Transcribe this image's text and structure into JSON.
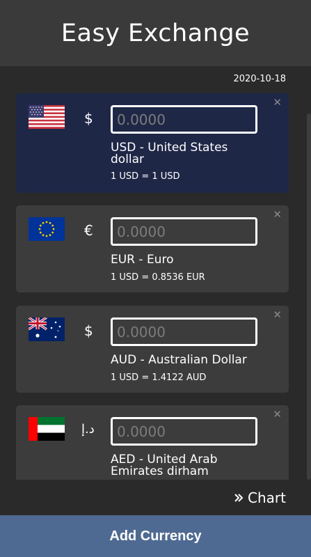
{
  "header": {
    "title": "Easy Exchange"
  },
  "date": "2020-10-18",
  "currencies": [
    {
      "code_name": "USD - United States dollar",
      "symbol": "$",
      "placeholder": "0.0000",
      "rate": "1 USD = 1 USD",
      "flag": "us-flag",
      "active": true
    },
    {
      "code_name": "EUR - Euro",
      "symbol": "€",
      "placeholder": "0.0000",
      "rate": "1 USD = 0.8536 EUR",
      "flag": "eu-flag",
      "active": false
    },
    {
      "code_name": "AUD - Australian Dollar",
      "symbol": "$",
      "placeholder": "0.0000",
      "rate": "1 USD = 1.4122 AUD",
      "flag": "au-flag",
      "active": false
    },
    {
      "code_name": "AED - United Arab Emirates dirham",
      "symbol": "د.إ",
      "placeholder": "0.0000",
      "rate": "",
      "flag": "ae-flag",
      "active": false
    }
  ],
  "close_glyph": "✕",
  "chart_link": {
    "label": "Chart",
    "icon": "double-chevron-right-icon"
  },
  "add_button": {
    "label": "Add Currency"
  },
  "colors": {
    "active_card": "#1f2747",
    "card": "#3c3c3c",
    "add_button": "#4f6a92",
    "header": "#3a3a3a"
  }
}
